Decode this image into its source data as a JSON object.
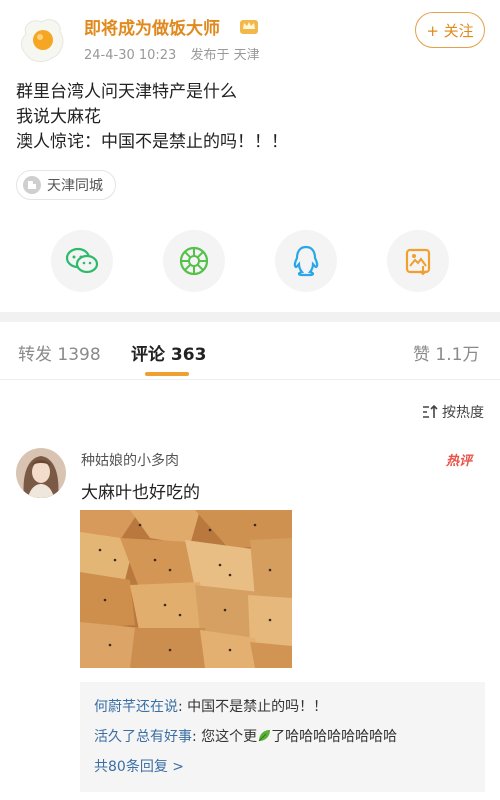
{
  "post": {
    "author": "即将成为做饭大师",
    "date": "24-4-30 10:23",
    "published_in": "发布于 天津",
    "follow_label": "+ 关注",
    "lines": [
      "群里台湾人问天津特产是什么",
      "我说大麻花",
      "澳人惊诧：中国不是禁止的吗！！！"
    ],
    "location_tag": "天津同城"
  },
  "share": {
    "items": [
      "wechat-icon",
      "moments-icon",
      "qq-icon",
      "save-image-icon"
    ]
  },
  "tabs": {
    "repost": "转发 1398",
    "comments": "评论 363",
    "likes": "赞 1.1万"
  },
  "sort": {
    "label": "按热度"
  },
  "comment": {
    "user": "种姑娘的小多肉",
    "badge": "热评",
    "text": "大麻叶也好吃的",
    "replies": [
      {
        "who": "何蔚芊还在说",
        "text": ": 中国不是禁止的吗！！"
      },
      {
        "who": "活久了总有好事",
        "text_before": ": 您这个更",
        "text_after": "了哈哈哈哈哈哈哈哈"
      }
    ],
    "more_replies": "共80条回复 >"
  },
  "colors": {
    "accent": "#e08a1e",
    "tab_underline": "#f0a030",
    "hot_badge": "#e8544a",
    "link": "#3b6ea5"
  }
}
